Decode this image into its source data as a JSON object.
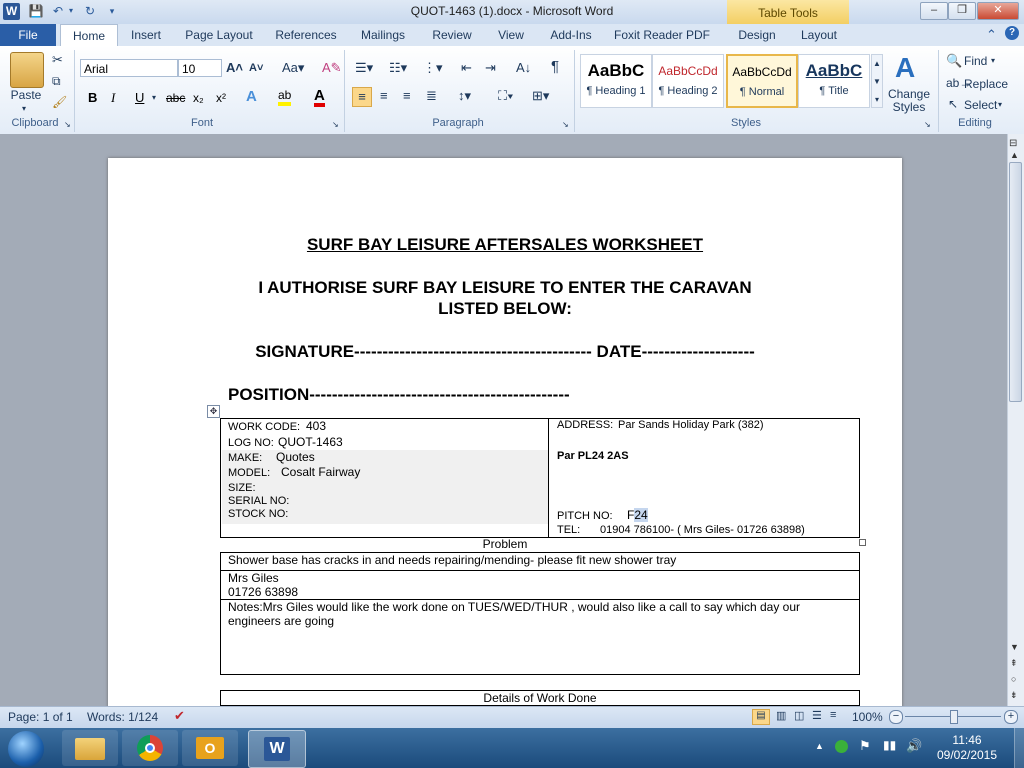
{
  "window": {
    "title": "QUOT-1463 (1).docx  -  Microsoft Word",
    "contextual_tab_group": "Table Tools",
    "minimize": "–",
    "maximize": "❐",
    "close": "✕"
  },
  "tabs": [
    {
      "label": "File"
    },
    {
      "label": "Home"
    },
    {
      "label": "Insert"
    },
    {
      "label": "Page Layout"
    },
    {
      "label": "References"
    },
    {
      "label": "Mailings"
    },
    {
      "label": "Review"
    },
    {
      "label": "View"
    },
    {
      "label": "Add-Ins"
    },
    {
      "label": "Foxit Reader PDF"
    },
    {
      "label": "Design"
    },
    {
      "label": "Layout"
    }
  ],
  "ribbon": {
    "clipboard": {
      "label": "Clipboard",
      "paste": "Paste"
    },
    "font": {
      "label": "Font",
      "font_name": "Arial",
      "font_size": "10"
    },
    "paragraph": {
      "label": "Paragraph"
    },
    "styles": {
      "label": "Styles",
      "items": [
        {
          "preview": "AaBbC",
          "name": "¶ Heading 1"
        },
        {
          "preview": "AaBbCcDd",
          "name": "¶ Heading 2"
        },
        {
          "preview": "AaBbCcDd",
          "name": "¶ Normal"
        },
        {
          "preview": "AaBbC",
          "name": "¶ Title"
        }
      ],
      "change_styles": "Change Styles"
    },
    "editing": {
      "label": "Editing",
      "find": "Find",
      "replace": "Replace",
      "select": "Select"
    }
  },
  "document": {
    "heading": "SURF BAY LEISURE AFTERSALES WORKSHEET",
    "authorise_line1": "I AUTHORISE SURF BAY LEISURE TO ENTER THE CARAVAN",
    "authorise_line2": "LISTED BELOW:",
    "signature_line": "SIGNATURE------------------------------------------ DATE--------------------",
    "position_line": "POSITION----------------------------------------------",
    "details_left": {
      "work_code_label": "WORK CODE:",
      "work_code": "403",
      "log_no_label": "LOG NO:",
      "log_no": "QUOT-1463",
      "make_label": "MAKE:",
      "make": "Quotes",
      "model_label": "MODEL:",
      "model": "Cosalt Fairway",
      "size_label": "SIZE:",
      "serial_label": "SERIAL  NO:",
      "stock_label": "STOCK NO:"
    },
    "details_right": {
      "address_label": "ADDRESS:",
      "address": "Par Sands Holiday Park (382)",
      "postcode": "Par PL24  2AS",
      "pitch_label": "PITCH NO:",
      "pitch_prefix": "F",
      "pitch_selected": "24",
      "tel_label": "TEL:",
      "tel": "01904 786100-  ( Mrs Giles- 01726  63898)"
    },
    "problem_label": "Problem",
    "problem_text": "Shower base has cracks in and needs repairing/mending- please fit new shower tray",
    "contact_name": "Mrs Giles",
    "contact_phone": "01726 63898",
    "notes_text": "Notes:Mrs Giles would like the work done on TUES/WED/THUR , would also like a call to say which day our engineers are going",
    "details_work_done": "Details of Work Done"
  },
  "status": {
    "page": "Page: 1 of 1",
    "words": "Words: 1/124",
    "zoom": "100%"
  },
  "taskbar": {
    "time": "11:46",
    "date": "09/02/2015"
  }
}
